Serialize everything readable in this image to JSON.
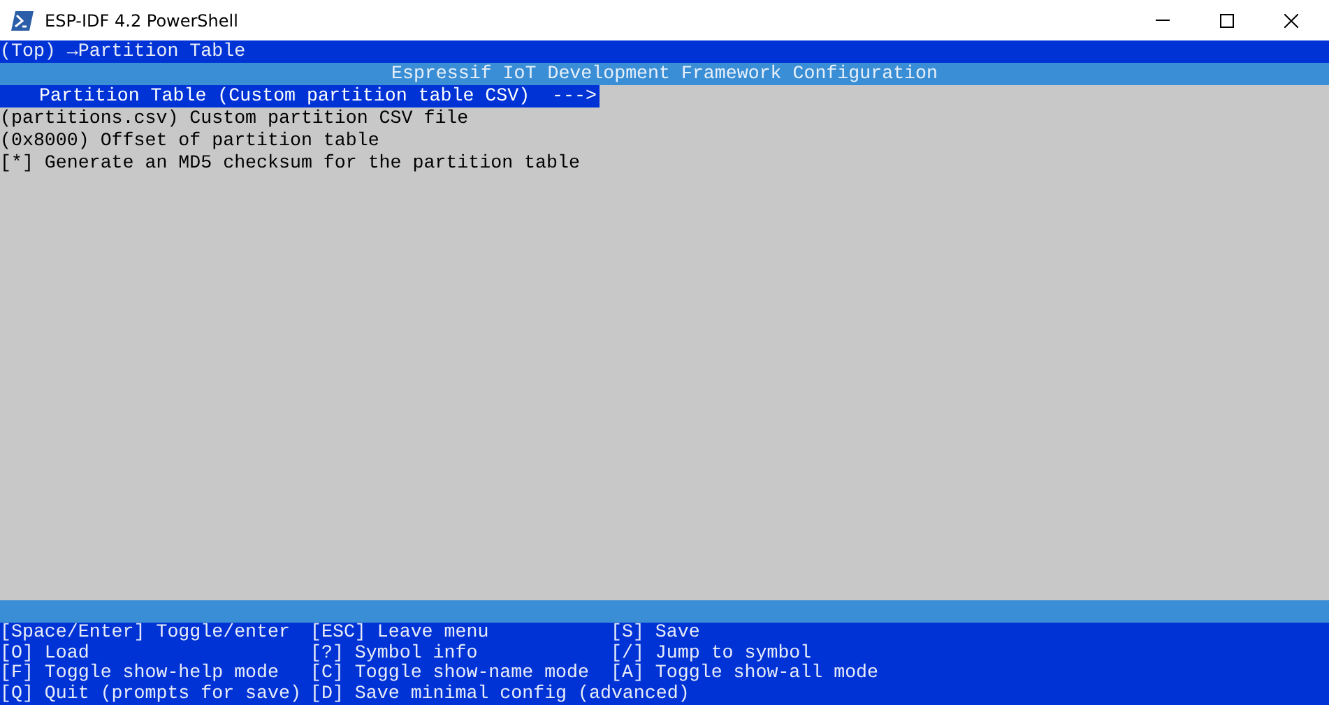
{
  "window": {
    "title": "ESP-IDF 4.2 PowerShell"
  },
  "breadcrumb": "(Top) →Partition Table",
  "header": "Espressif IoT Development Framework Configuration",
  "items": [
    {
      "text": "Partition Table (Custom partition table CSV)  --->",
      "selected": true
    },
    {
      "text": "(partitions.csv) Custom partition CSV file",
      "selected": false
    },
    {
      "text": "(0x8000) Offset of partition table",
      "selected": false
    },
    {
      "text": "[*] Generate an MD5 checksum for the partition table",
      "selected": false
    }
  ],
  "help": [
    [
      "[Space/Enter] Toggle/enter",
      "[ESC] Leave menu",
      "[S] Save"
    ],
    [
      "[O] Load",
      "[?] Symbol info",
      "[/] Jump to symbol"
    ],
    [
      "[F] Toggle show-help mode",
      "[C] Toggle show-name mode",
      "[A] Toggle show-all mode"
    ],
    [
      "[Q] Quit (prompts for save)",
      "[D] Save minimal config (advanced)"
    ]
  ]
}
